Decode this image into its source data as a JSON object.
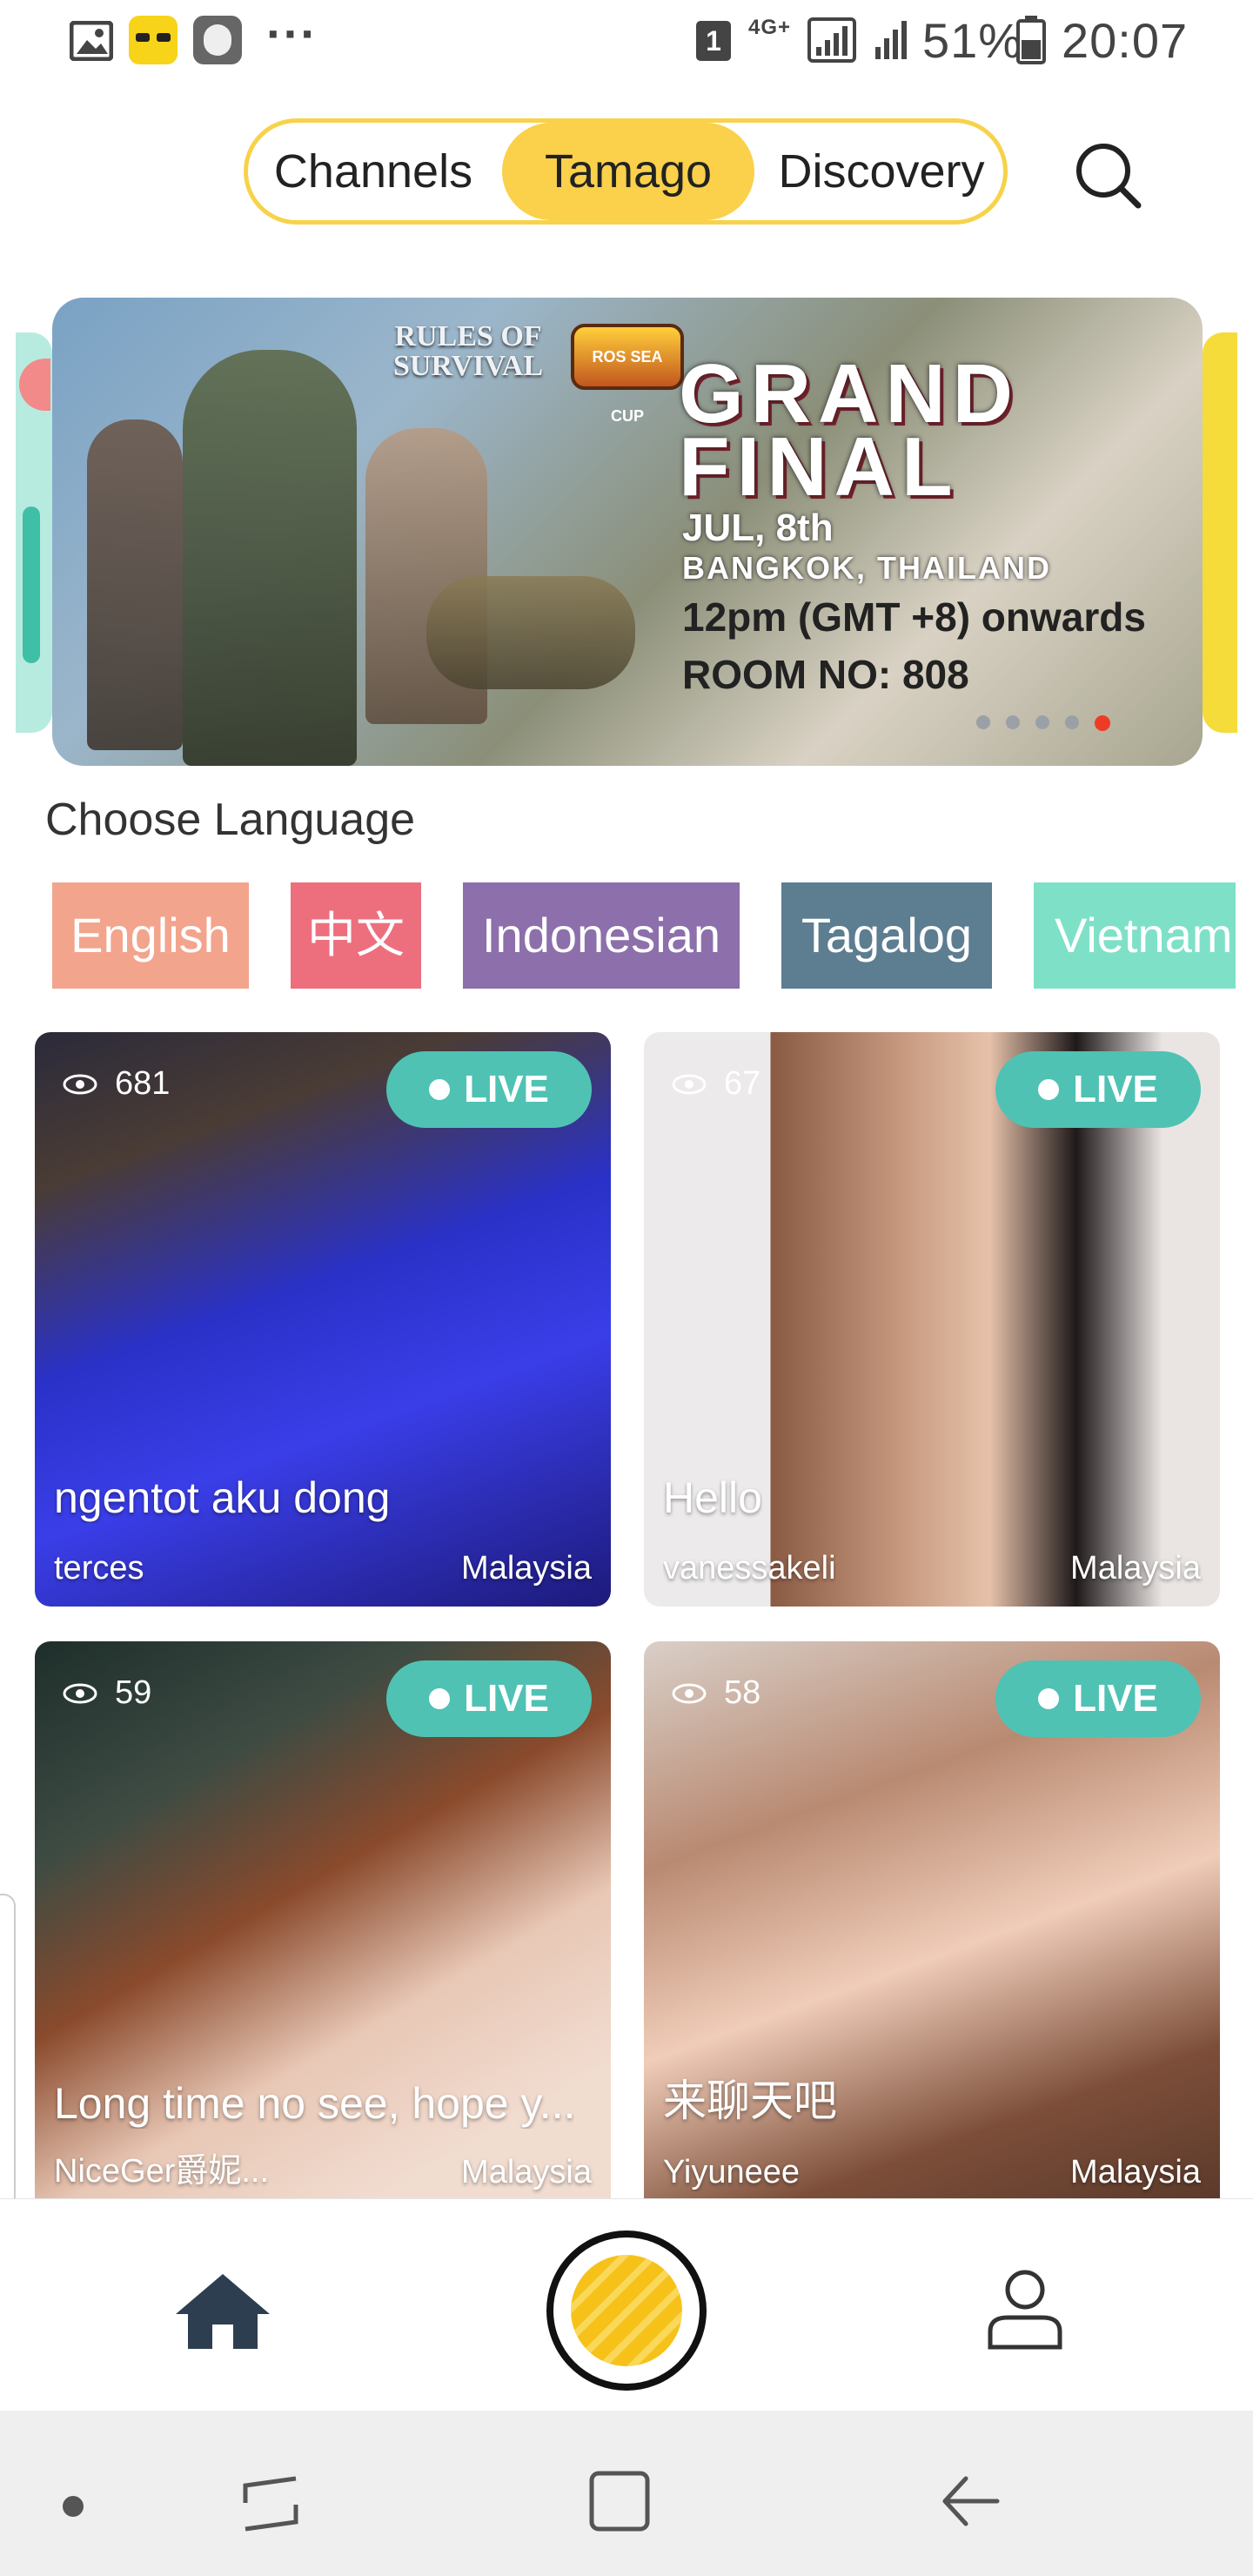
{
  "status_bar": {
    "sim": "1",
    "network": "4G+",
    "battery": "51%",
    "time": "20:07",
    "more": "···",
    "icons": [
      "gallery-icon",
      "tamago-app-icon",
      "bot-icon",
      "sim-icon",
      "signal-icon",
      "battery-icon"
    ]
  },
  "tabs": {
    "items": [
      {
        "label": "Channels"
      },
      {
        "label": "Tamago"
      },
      {
        "label": "Discovery"
      }
    ],
    "active": "Tamago",
    "search_icon": "search-icon"
  },
  "banner": {
    "game": "RULES OF SURVIVAL",
    "event_badge": "ROS SEA CUP",
    "headline_1": "GRAND",
    "headline_2": "FINAL",
    "date": "JUL, 8th",
    "location": "BANGKOK, THAILAND",
    "time": "12pm (GMT +8) onwards",
    "room": "ROOM NO: 808"
  },
  "language": {
    "title": "Choose Language",
    "chips": [
      {
        "label": "English",
        "color": "#f3a48d"
      },
      {
        "label": "中文",
        "color": "#ed6f7d"
      },
      {
        "label": "Indonesian",
        "color": "#8c6fab"
      },
      {
        "label": "Tagalog",
        "color": "#5d7d90"
      },
      {
        "label": "Vietnam",
        "color": "#7fe0c8"
      }
    ]
  },
  "streams": [
    {
      "views": "681",
      "live": "LIVE",
      "title": "ngentot aku dong",
      "user": "terces",
      "country": "Malaysia"
    },
    {
      "views": "67",
      "live": "LIVE",
      "title": "Hello",
      "user": "vanessakeli",
      "country": "Malaysia"
    },
    {
      "views": "59",
      "live": "LIVE",
      "title": "Long time no see, hope y...",
      "user": "NiceGer爵妮...",
      "country": "Malaysia"
    },
    {
      "views": "58",
      "live": "LIVE",
      "title": "来聊天吧",
      "user": "Yiyuneee",
      "country": "Malaysia"
    }
  ],
  "bottom_nav": {
    "icons": [
      "home-icon",
      "tamago-center-icon",
      "profile-icon"
    ]
  },
  "system_nav": {
    "icons": [
      "dot-icon",
      "recents-icon",
      "home-square-icon",
      "back-icon"
    ]
  },
  "colors": {
    "accent_yellow": "#fbd04a",
    "live_teal": "#4fc2b4"
  }
}
